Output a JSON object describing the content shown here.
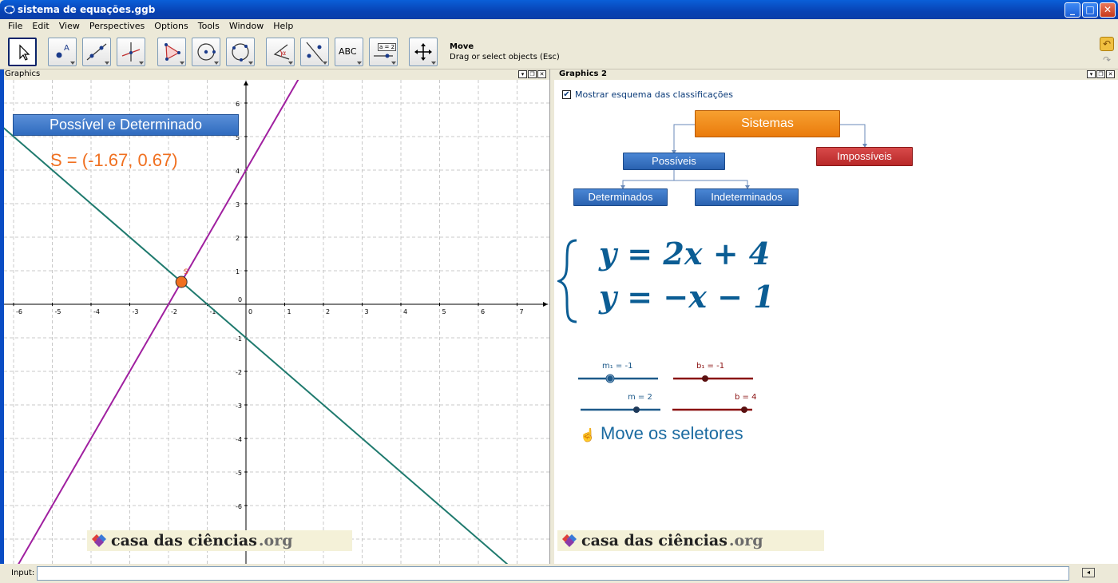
{
  "window": {
    "title": "sistema de equações.ggb"
  },
  "menu": [
    "File",
    "Edit",
    "View",
    "Perspectives",
    "Options",
    "Tools",
    "Window",
    "Help"
  ],
  "toolbar": {
    "active_tool_title": "Move",
    "active_tool_desc": "Drag or select objects (Esc)",
    "text_tool_label": "ABC",
    "slider_tool_label": "a = 2"
  },
  "graphics1": {
    "header": "Graphics",
    "banner": "Possível e Determinado",
    "solution": "S = (-1.67, 0.67)",
    "point_label": "S",
    "x_ticks": [
      "-6",
      "-5",
      "-4",
      "-3",
      "-2",
      "-1",
      "0",
      "1",
      "2",
      "3",
      "4",
      "5",
      "6",
      "7"
    ],
    "y_ticks": [
      "6",
      "5",
      "4",
      "3",
      "2",
      "1",
      "-1",
      "-2",
      "-3",
      "-4",
      "-5",
      "-6"
    ],
    "line1_color": "#a020a0",
    "line2_color": "#1f7a6e",
    "point_color": "#f07020",
    "logo_text": "casa das ciências",
    "logo_org": ".org"
  },
  "graphics2": {
    "header": "Graphics 2",
    "checkbox_label": "Mostrar esquema das classificações",
    "checkbox_checked": true,
    "scheme": {
      "root": "Sistemas",
      "possible": "Possíveis",
      "impossible": "Impossíveis",
      "determined": "Determinados",
      "undetermined": "Indeterminados"
    },
    "equation1": "y = 2x + 4",
    "equation2": "y = −x − 1",
    "sliders": {
      "m1_label": "m₁ = -1",
      "b1_label": "b₁ = -1",
      "m_label": "m = 2",
      "b_label": "b = 4"
    },
    "hint": "Move os seletores",
    "logo_text": "casa das ciências",
    "logo_org": ".org"
  },
  "input": {
    "label": "Input:",
    "value": ""
  }
}
